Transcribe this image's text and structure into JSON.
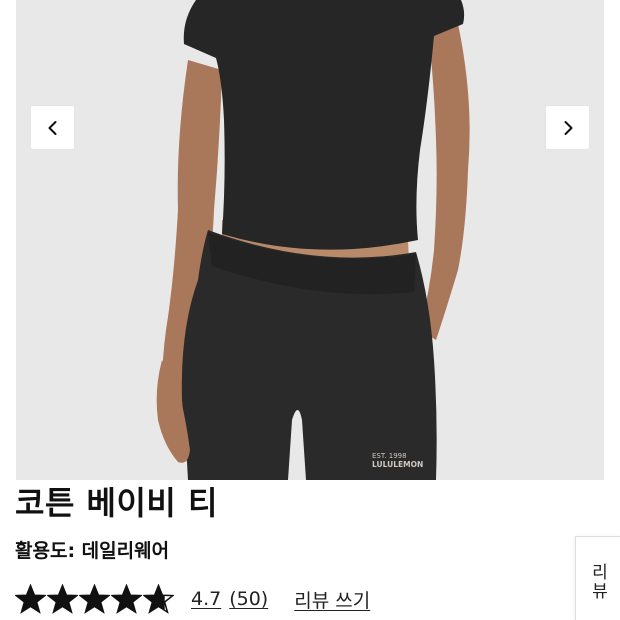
{
  "gallery": {
    "prev_icon": "chevron-left-icon",
    "next_icon": "chevron-right-icon",
    "print_text_line1": "EST. 1998",
    "print_text_line2": "LULULEMON"
  },
  "product": {
    "title": "코튼 베이비 티",
    "activity": "활용도: 데일리웨어",
    "rating_value": "4.7",
    "review_count": "(50)",
    "write_review": "리뷰 쓰기",
    "rating_stars": 4.7,
    "rating_max": 5
  },
  "side_tab": {
    "label": "리뷰"
  },
  "colors": {
    "star": "#111111",
    "image_bg": "#e9e9e9",
    "garment": "#2a2a2a"
  }
}
